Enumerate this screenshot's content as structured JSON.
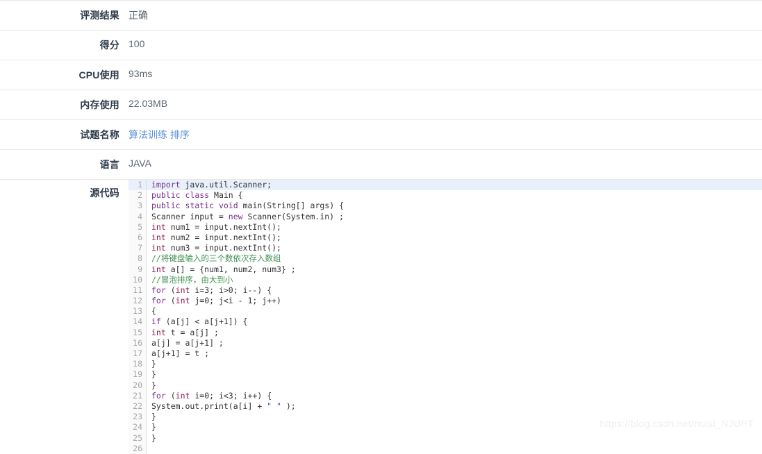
{
  "info_rows": [
    {
      "label": "评测结果",
      "value": "正确",
      "is_link": false
    },
    {
      "label": "得分",
      "value": "100",
      "is_link": false
    },
    {
      "label": "CPU使用",
      "value": "93ms",
      "is_link": false
    },
    {
      "label": "内存使用",
      "value": "22.03MB",
      "is_link": false
    },
    {
      "label": "试题名称",
      "value": "算法训练 排序",
      "is_link": true
    },
    {
      "label": "语言",
      "value": "JAVA",
      "is_link": false
    }
  ],
  "source_code": {
    "label": "源代码",
    "language": "JAVA",
    "active_line": 1,
    "total_lines": 26,
    "lines": [
      {
        "n": "1",
        "tokens": [
          {
            "t": "kw",
            "s": "import"
          },
          {
            "t": "pln",
            "s": " java.util.Scanner;"
          }
        ]
      },
      {
        "n": "2",
        "tokens": [
          {
            "t": "kw",
            "s": "public"
          },
          {
            "t": "pln",
            "s": " "
          },
          {
            "t": "kw",
            "s": "class"
          },
          {
            "t": "pln",
            "s": " Main {"
          }
        ]
      },
      {
        "n": "3",
        "tokens": [
          {
            "t": "kw",
            "s": "public"
          },
          {
            "t": "pln",
            "s": " "
          },
          {
            "t": "kw",
            "s": "static"
          },
          {
            "t": "pln",
            "s": " "
          },
          {
            "t": "kw",
            "s": "void"
          },
          {
            "t": "pln",
            "s": " main(String[] args) {"
          }
        ]
      },
      {
        "n": "4",
        "tokens": [
          {
            "t": "pln",
            "s": "Scanner input = "
          },
          {
            "t": "kw",
            "s": "new"
          },
          {
            "t": "pln",
            "s": " Scanner(System.in) ;"
          }
        ]
      },
      {
        "n": "5",
        "tokens": [
          {
            "t": "type",
            "s": "int"
          },
          {
            "t": "pln",
            "s": " num1 = input.nextInt();"
          }
        ]
      },
      {
        "n": "6",
        "tokens": [
          {
            "t": "type",
            "s": "int"
          },
          {
            "t": "pln",
            "s": " num2 = input.nextInt();"
          }
        ]
      },
      {
        "n": "7",
        "tokens": [
          {
            "t": "type",
            "s": "int"
          },
          {
            "t": "pln",
            "s": " num3 = input.nextInt();"
          }
        ]
      },
      {
        "n": "8",
        "tokens": [
          {
            "t": "cmt",
            "s": "//将键盘输入的三个数依次存入数组"
          }
        ]
      },
      {
        "n": "9",
        "tokens": [
          {
            "t": "type",
            "s": "int"
          },
          {
            "t": "pln",
            "s": " a[] = {num1, num2, num3} ;"
          }
        ]
      },
      {
        "n": "10",
        "tokens": [
          {
            "t": "cmt",
            "s": "//冒泡排序，由大到小"
          }
        ]
      },
      {
        "n": "11",
        "tokens": [
          {
            "t": "kw",
            "s": "for"
          },
          {
            "t": "pln",
            "s": " ("
          },
          {
            "t": "type",
            "s": "int"
          },
          {
            "t": "pln",
            "s": " i=3; i>0; i--) {"
          }
        ]
      },
      {
        "n": "12",
        "tokens": [
          {
            "t": "kw",
            "s": "for"
          },
          {
            "t": "pln",
            "s": " ("
          },
          {
            "t": "type",
            "s": "int"
          },
          {
            "t": "pln",
            "s": " j=0; j<i - 1; j++)"
          }
        ]
      },
      {
        "n": "13",
        "tokens": [
          {
            "t": "pln",
            "s": "{"
          }
        ]
      },
      {
        "n": "14",
        "tokens": [
          {
            "t": "kw",
            "s": "if"
          },
          {
            "t": "pln",
            "s": " (a[j] < a[j+1]) {"
          }
        ]
      },
      {
        "n": "15",
        "tokens": [
          {
            "t": "type",
            "s": "int"
          },
          {
            "t": "pln",
            "s": " t = a[j] ;"
          }
        ]
      },
      {
        "n": "16",
        "tokens": [
          {
            "t": "pln",
            "s": "a[j] = a[j+1] ;"
          }
        ]
      },
      {
        "n": "17",
        "tokens": [
          {
            "t": "pln",
            "s": "a[j+1] = t ;"
          }
        ]
      },
      {
        "n": "18",
        "tokens": [
          {
            "t": "pln",
            "s": "}"
          }
        ]
      },
      {
        "n": "19",
        "tokens": [
          {
            "t": "pln",
            "s": "}"
          }
        ]
      },
      {
        "n": "20",
        "tokens": [
          {
            "t": "pln",
            "s": "}"
          }
        ]
      },
      {
        "n": "21",
        "tokens": [
          {
            "t": "kw",
            "s": "for"
          },
          {
            "t": "pln",
            "s": " ("
          },
          {
            "t": "type",
            "s": "int"
          },
          {
            "t": "pln",
            "s": " i=0; i<3; i++) {"
          }
        ]
      },
      {
        "n": "22",
        "tokens": [
          {
            "t": "pln",
            "s": "System.out.print(a[i] + "
          },
          {
            "t": "str",
            "s": "\" \""
          },
          {
            "t": "pln",
            "s": " );"
          }
        ]
      },
      {
        "n": "23",
        "tokens": [
          {
            "t": "pln",
            "s": "}"
          }
        ]
      },
      {
        "n": "24",
        "tokens": [
          {
            "t": "pln",
            "s": "}"
          }
        ]
      },
      {
        "n": "25",
        "tokens": [
          {
            "t": "pln",
            "s": "}"
          }
        ]
      },
      {
        "n": "26",
        "tokens": [
          {
            "t": "pln",
            "s": ""
          }
        ]
      }
    ]
  },
  "watermark": "https://blog.csdn.net/nuist_NJUPT",
  "colors": {
    "label_text": "#2f3b4a",
    "value_text": "#5a6472",
    "link": "#5b8fd9",
    "row_border": "#e8e8e8",
    "active_line_bg": "#e8f1fb",
    "gutter_bg": "#fafafa",
    "keyword": "#7b2d8e",
    "type": "#8a1b4f",
    "comment": "#3f8f4f",
    "string": "#2b55c6",
    "watermark": "#efefef"
  }
}
